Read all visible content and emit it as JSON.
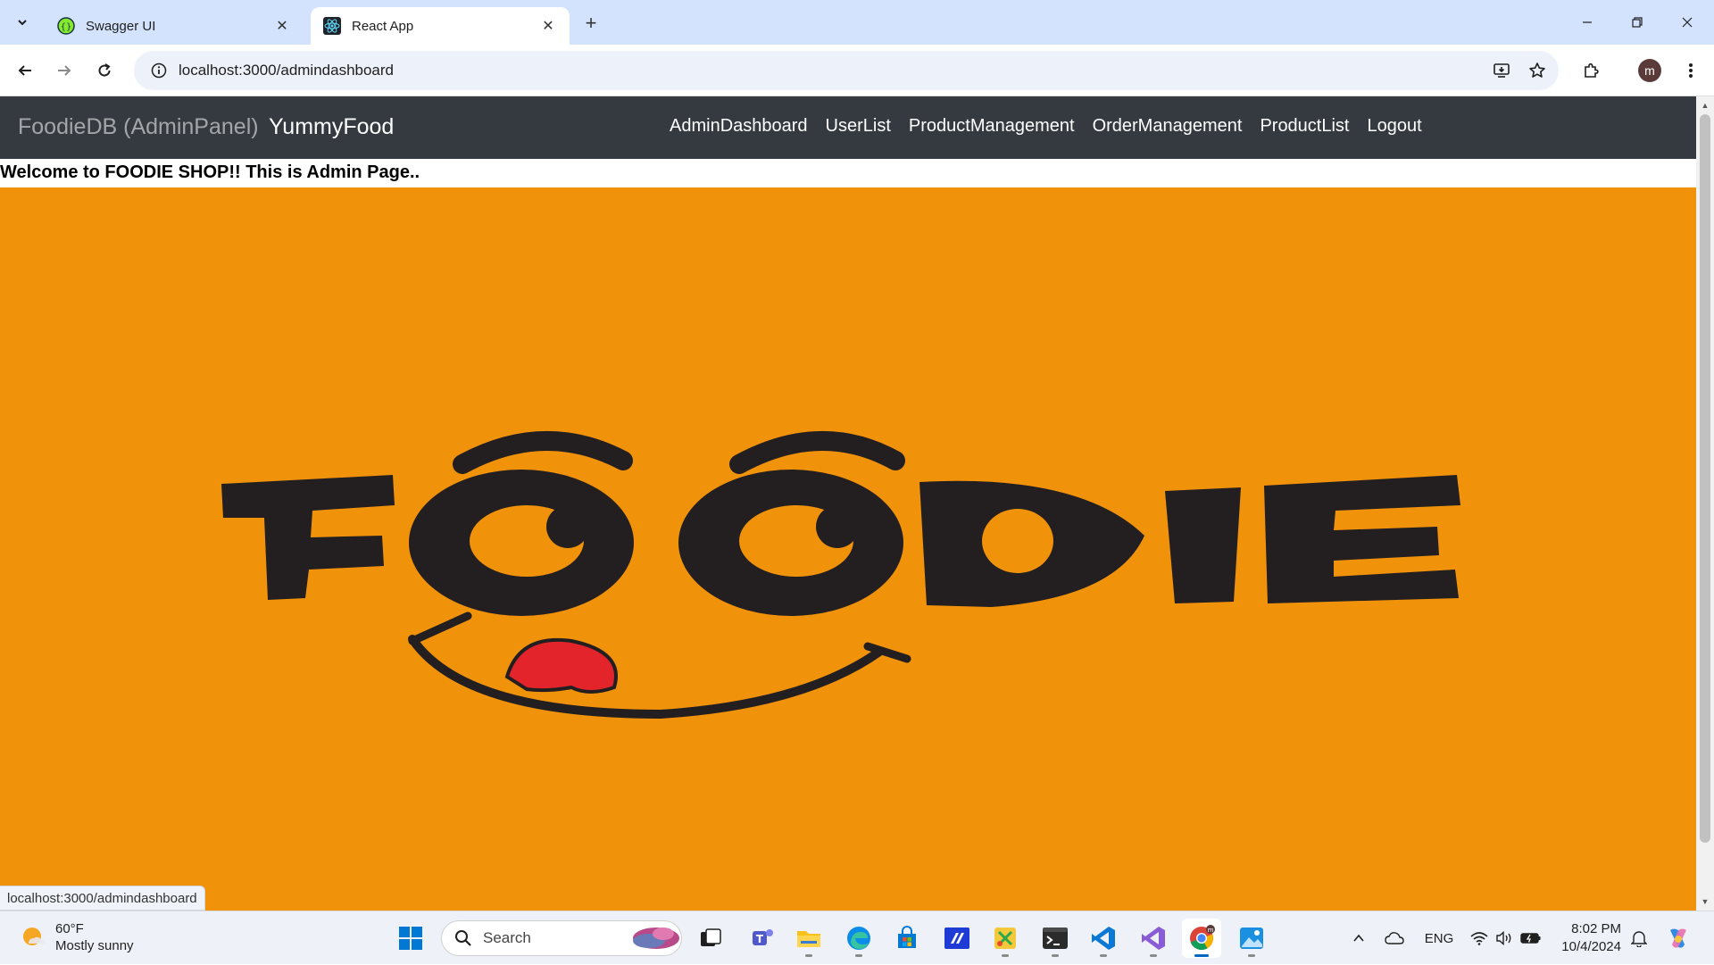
{
  "browser": {
    "tabs": [
      {
        "label": "Swagger UI",
        "icon": "swagger-icon",
        "active": false
      },
      {
        "label": "React App",
        "icon": "react-icon",
        "active": true
      }
    ],
    "url": "localhost:3000/admindashboard",
    "status_url": "localhost:3000/admindashboard",
    "profile_initial": "m"
  },
  "navbar": {
    "brand_primary": "FoodieDB (AdminPanel)",
    "brand_secondary": "YummyFood",
    "links": [
      "AdminDashboard",
      "UserList",
      "ProductManagement",
      "OrderManagement",
      "ProductList",
      "Logout"
    ]
  },
  "page": {
    "welcome": "Welcome to FOODIE SHOP!! This is Admin Page..",
    "hero_logo_text": "FOODIE",
    "hero_bg_color": "#f0920a"
  },
  "taskbar": {
    "weather": {
      "temp": "60°F",
      "condition": "Mostly sunny"
    },
    "search_label": "Search",
    "language": "ENG",
    "time": "8:02 PM",
    "date": "10/4/2024"
  }
}
